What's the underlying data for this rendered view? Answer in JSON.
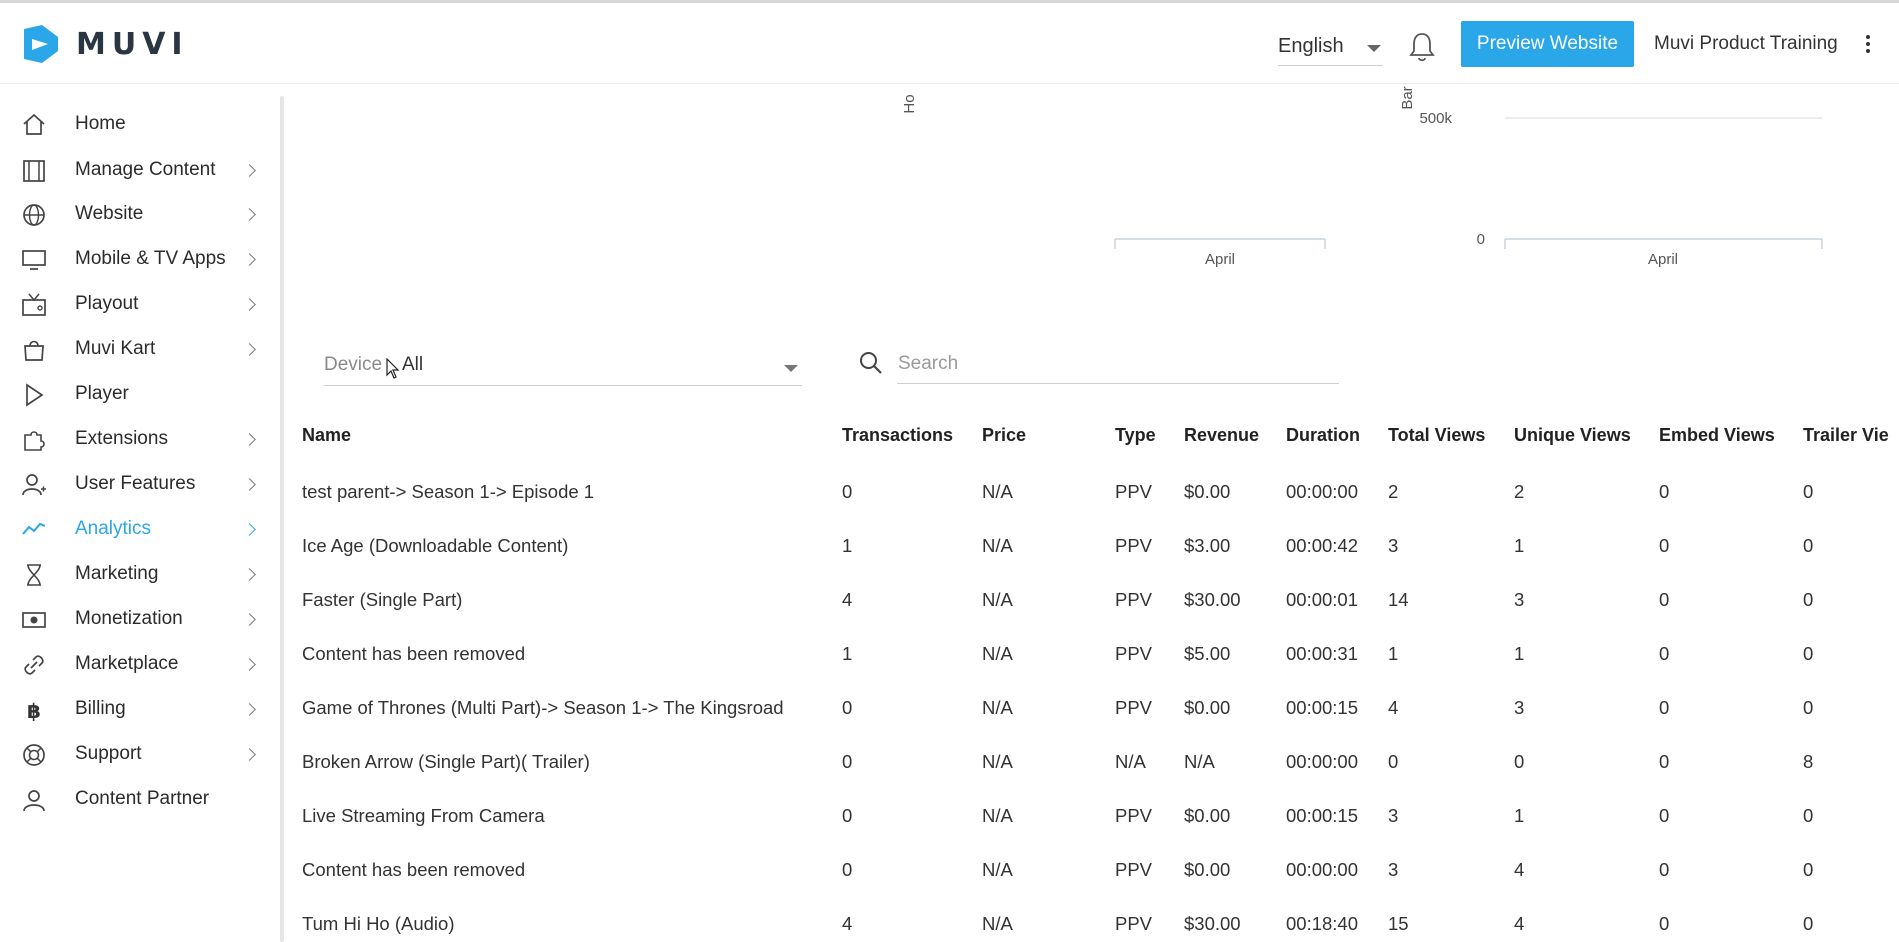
{
  "header": {
    "logo_text": "MUVI",
    "language": "English",
    "preview_button": "Preview Website",
    "account_name": "Muvi Product Training"
  },
  "sidebar": {
    "items": [
      {
        "label": "Home",
        "icon": "home-icon",
        "chevron": false,
        "active": false
      },
      {
        "label": "Manage Content",
        "icon": "film-icon",
        "chevron": true,
        "active": false
      },
      {
        "label": "Website",
        "icon": "globe-icon",
        "chevron": true,
        "active": false
      },
      {
        "label": "Mobile & TV Apps",
        "icon": "monitor-icon",
        "chevron": true,
        "active": false
      },
      {
        "label": "Playout",
        "icon": "tv-icon",
        "chevron": true,
        "active": false
      },
      {
        "label": "Muvi Kart",
        "icon": "shopping-bag-icon",
        "chevron": true,
        "active": false
      },
      {
        "label": "Player",
        "icon": "play-icon",
        "chevron": false,
        "active": false
      },
      {
        "label": "Extensions",
        "icon": "puzzle-icon",
        "chevron": true,
        "active": false
      },
      {
        "label": "User Features",
        "icon": "user-plus-icon",
        "chevron": true,
        "active": false
      },
      {
        "label": "Analytics",
        "icon": "trend-line-icon",
        "chevron": true,
        "active": true
      },
      {
        "label": "Marketing",
        "icon": "hourglass-icon",
        "chevron": true,
        "active": false
      },
      {
        "label": "Monetization",
        "icon": "money-icon",
        "chevron": true,
        "active": false
      },
      {
        "label": "Marketplace",
        "icon": "link-icon",
        "chevron": true,
        "active": false
      },
      {
        "label": "Billing",
        "icon": "bitcoin-icon",
        "chevron": true,
        "active": false
      },
      {
        "label": "Support",
        "icon": "lifebuoy-icon",
        "chevron": true,
        "active": false
      },
      {
        "label": "Content Partner",
        "icon": "user-icon",
        "chevron": false,
        "active": false
      }
    ]
  },
  "charts": {
    "left": {
      "ylabel": "Ho",
      "xtick": "April"
    },
    "right": {
      "ylabel": "Bar",
      "yticks": [
        "500k",
        "0"
      ],
      "xtick": "April"
    }
  },
  "chart_data": [
    {
      "type": "bar",
      "ylabel": "Ho",
      "categories": [
        "April"
      ],
      "values": []
    },
    {
      "type": "bar",
      "ylabel": "Bar",
      "categories": [
        "April"
      ],
      "values": [],
      "ylim": [
        0,
        500000
      ],
      "yticks": [
        "500k",
        "0"
      ]
    }
  ],
  "filters": {
    "device_label": "Device",
    "device_value": "All",
    "search_placeholder": "Search"
  },
  "table": {
    "columns": [
      "Name",
      "Transactions",
      "Price",
      "Type",
      "Revenue",
      "Duration",
      "Total Views",
      "Unique Views",
      "Embed Views",
      "Trailer Vie"
    ],
    "rows": [
      [
        "test parent-> Season 1-> Episode 1",
        "0",
        "N/A",
        "PPV",
        "$0.00",
        "00:00:00",
        "2",
        "2",
        "0",
        "0"
      ],
      [
        "Ice Age (Downloadable Content)",
        "1",
        "N/A",
        "PPV",
        "$3.00",
        "00:00:42",
        "3",
        "1",
        "0",
        "0"
      ],
      [
        "Faster (Single Part)",
        "4",
        "N/A",
        "PPV",
        "$30.00",
        "00:00:01",
        "14",
        "3",
        "0",
        "0"
      ],
      [
        "Content has been removed",
        "1",
        "N/A",
        "PPV",
        "$5.00",
        "00:00:31",
        "1",
        "1",
        "0",
        "0"
      ],
      [
        "Game of Thrones (Multi Part)-> Season 1-> The Kingsroad",
        "0",
        "N/A",
        "PPV",
        "$0.00",
        "00:00:15",
        "4",
        "3",
        "0",
        "0"
      ],
      [
        "Broken Arrow (Single Part)( Trailer)",
        "0",
        "N/A",
        "N/A",
        "N/A",
        "00:00:00",
        "0",
        "0",
        "0",
        "8"
      ],
      [
        "Live Streaming From Camera",
        "0",
        "N/A",
        "PPV",
        "$0.00",
        "00:00:15",
        "3",
        "1",
        "0",
        "0"
      ],
      [
        "Content has been removed",
        "0",
        "N/A",
        "PPV",
        "$0.00",
        "00:00:00",
        "3",
        "4",
        "0",
        "0"
      ],
      [
        "Tum Hi Ho (Audio)",
        "4",
        "N/A",
        "PPV",
        "$30.00",
        "00:18:40",
        "15",
        "4",
        "0",
        "0"
      ]
    ]
  },
  "colors": {
    "accent": "#2aa7e8",
    "text": "#2b2b2b"
  }
}
